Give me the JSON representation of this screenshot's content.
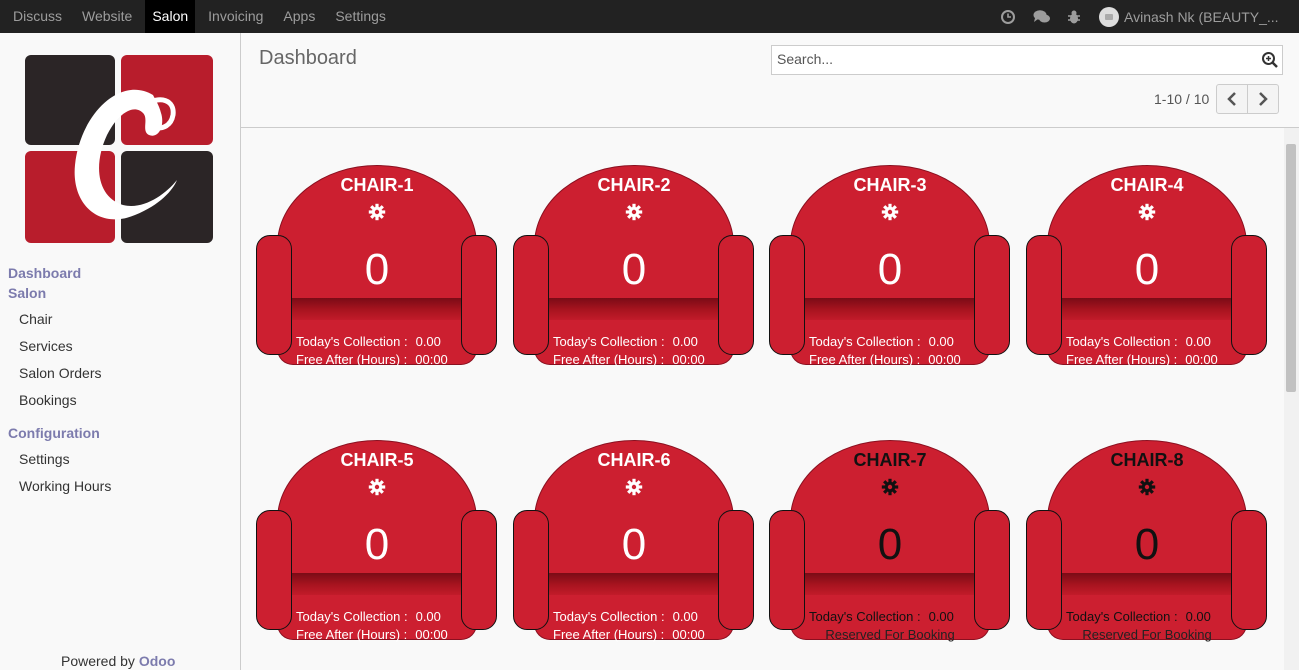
{
  "topbar": {
    "menu": [
      "Discuss",
      "Website",
      "Salon",
      "Invoicing",
      "Apps",
      "Settings"
    ],
    "active": "Salon",
    "user": "Avinash Nk (BEAUTY_..."
  },
  "sidebar": {
    "dashboard": "Dashboard",
    "salon": "Salon",
    "salon_items": [
      "Chair",
      "Services",
      "Salon Orders",
      "Bookings"
    ],
    "configuration": "Configuration",
    "config_items": [
      "Settings",
      "Working Hours"
    ],
    "powered_by": "Powered by",
    "powered_brand": "Odoo"
  },
  "header": {
    "title": "Dashboard",
    "search_placeholder": "Search...",
    "pager": "1-10 / 10"
  },
  "colors": {
    "chair_red": "#cc1f30",
    "brand": "#7c7bad",
    "topbar": "#222222"
  },
  "chairs": [
    {
      "name": "CHAIR-1",
      "count": "0",
      "collection_label": "Today's Collection :",
      "collection": "0.00",
      "free_label": "Free After (Hours) :",
      "free": "00:00"
    },
    {
      "name": "CHAIR-2",
      "count": "0",
      "collection_label": "Today's Collection :",
      "collection": "0.00",
      "free_label": "Free After (Hours) :",
      "free": "00:00"
    },
    {
      "name": "CHAIR-3",
      "count": "0",
      "collection_label": "Today's Collection :",
      "collection": "0.00",
      "free_label": "Free After (Hours) :",
      "free": "00:00"
    },
    {
      "name": "CHAIR-4",
      "count": "0",
      "collection_label": "Today's Collection :",
      "collection": "0.00",
      "free_label": "Free After (Hours) :",
      "free": "00:00"
    },
    {
      "name": "CHAIR-5",
      "count": "0",
      "collection_label": "Today's Collection :",
      "collection": "0.00",
      "free_label": "Free After (Hours) :",
      "free": "00:00"
    },
    {
      "name": "CHAIR-6",
      "count": "0",
      "collection_label": "Today's Collection :",
      "collection": "0.00",
      "free_label": "Free After (Hours) :",
      "free": "00:00"
    },
    {
      "name": "CHAIR-7",
      "count": "0",
      "collection_label": "Today's Collection :",
      "collection": "0.00",
      "status": "Reserved For Booking"
    },
    {
      "name": "CHAIR-8",
      "count": "0",
      "collection_label": "Today's Collection :",
      "collection": "0.00",
      "status": "Reserved For Booking"
    }
  ]
}
